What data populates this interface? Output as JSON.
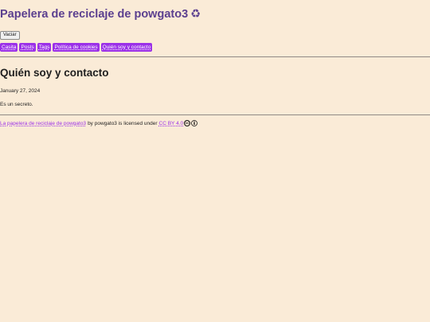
{
  "header": {
    "site_title": "Papelera de reciclaje de powgato3",
    "title_icon": "recycle-icon",
    "title_icon_glyph": "♻"
  },
  "actions": {
    "empty_label": "Vaciar"
  },
  "nav": {
    "items": [
      {
        "label": "Casita"
      },
      {
        "label": "Posts"
      },
      {
        "label": "Tags"
      },
      {
        "label": "Política de cookies"
      },
      {
        "label": "Quién soy y contacto"
      }
    ]
  },
  "post": {
    "title": "Quién soy y contacto",
    "date": "January 27, 2024",
    "body": "Es un secreto."
  },
  "footer": {
    "site_link": "La papelera de reciclaje de powgato3",
    "by_text": "by powgato3 is licensed under",
    "license_link": "CC BY 4.0",
    "cc_glyph": "cc"
  },
  "colors": {
    "background": "#faebd7",
    "title": "#5b3f8f",
    "accent": "#9b30e8"
  }
}
